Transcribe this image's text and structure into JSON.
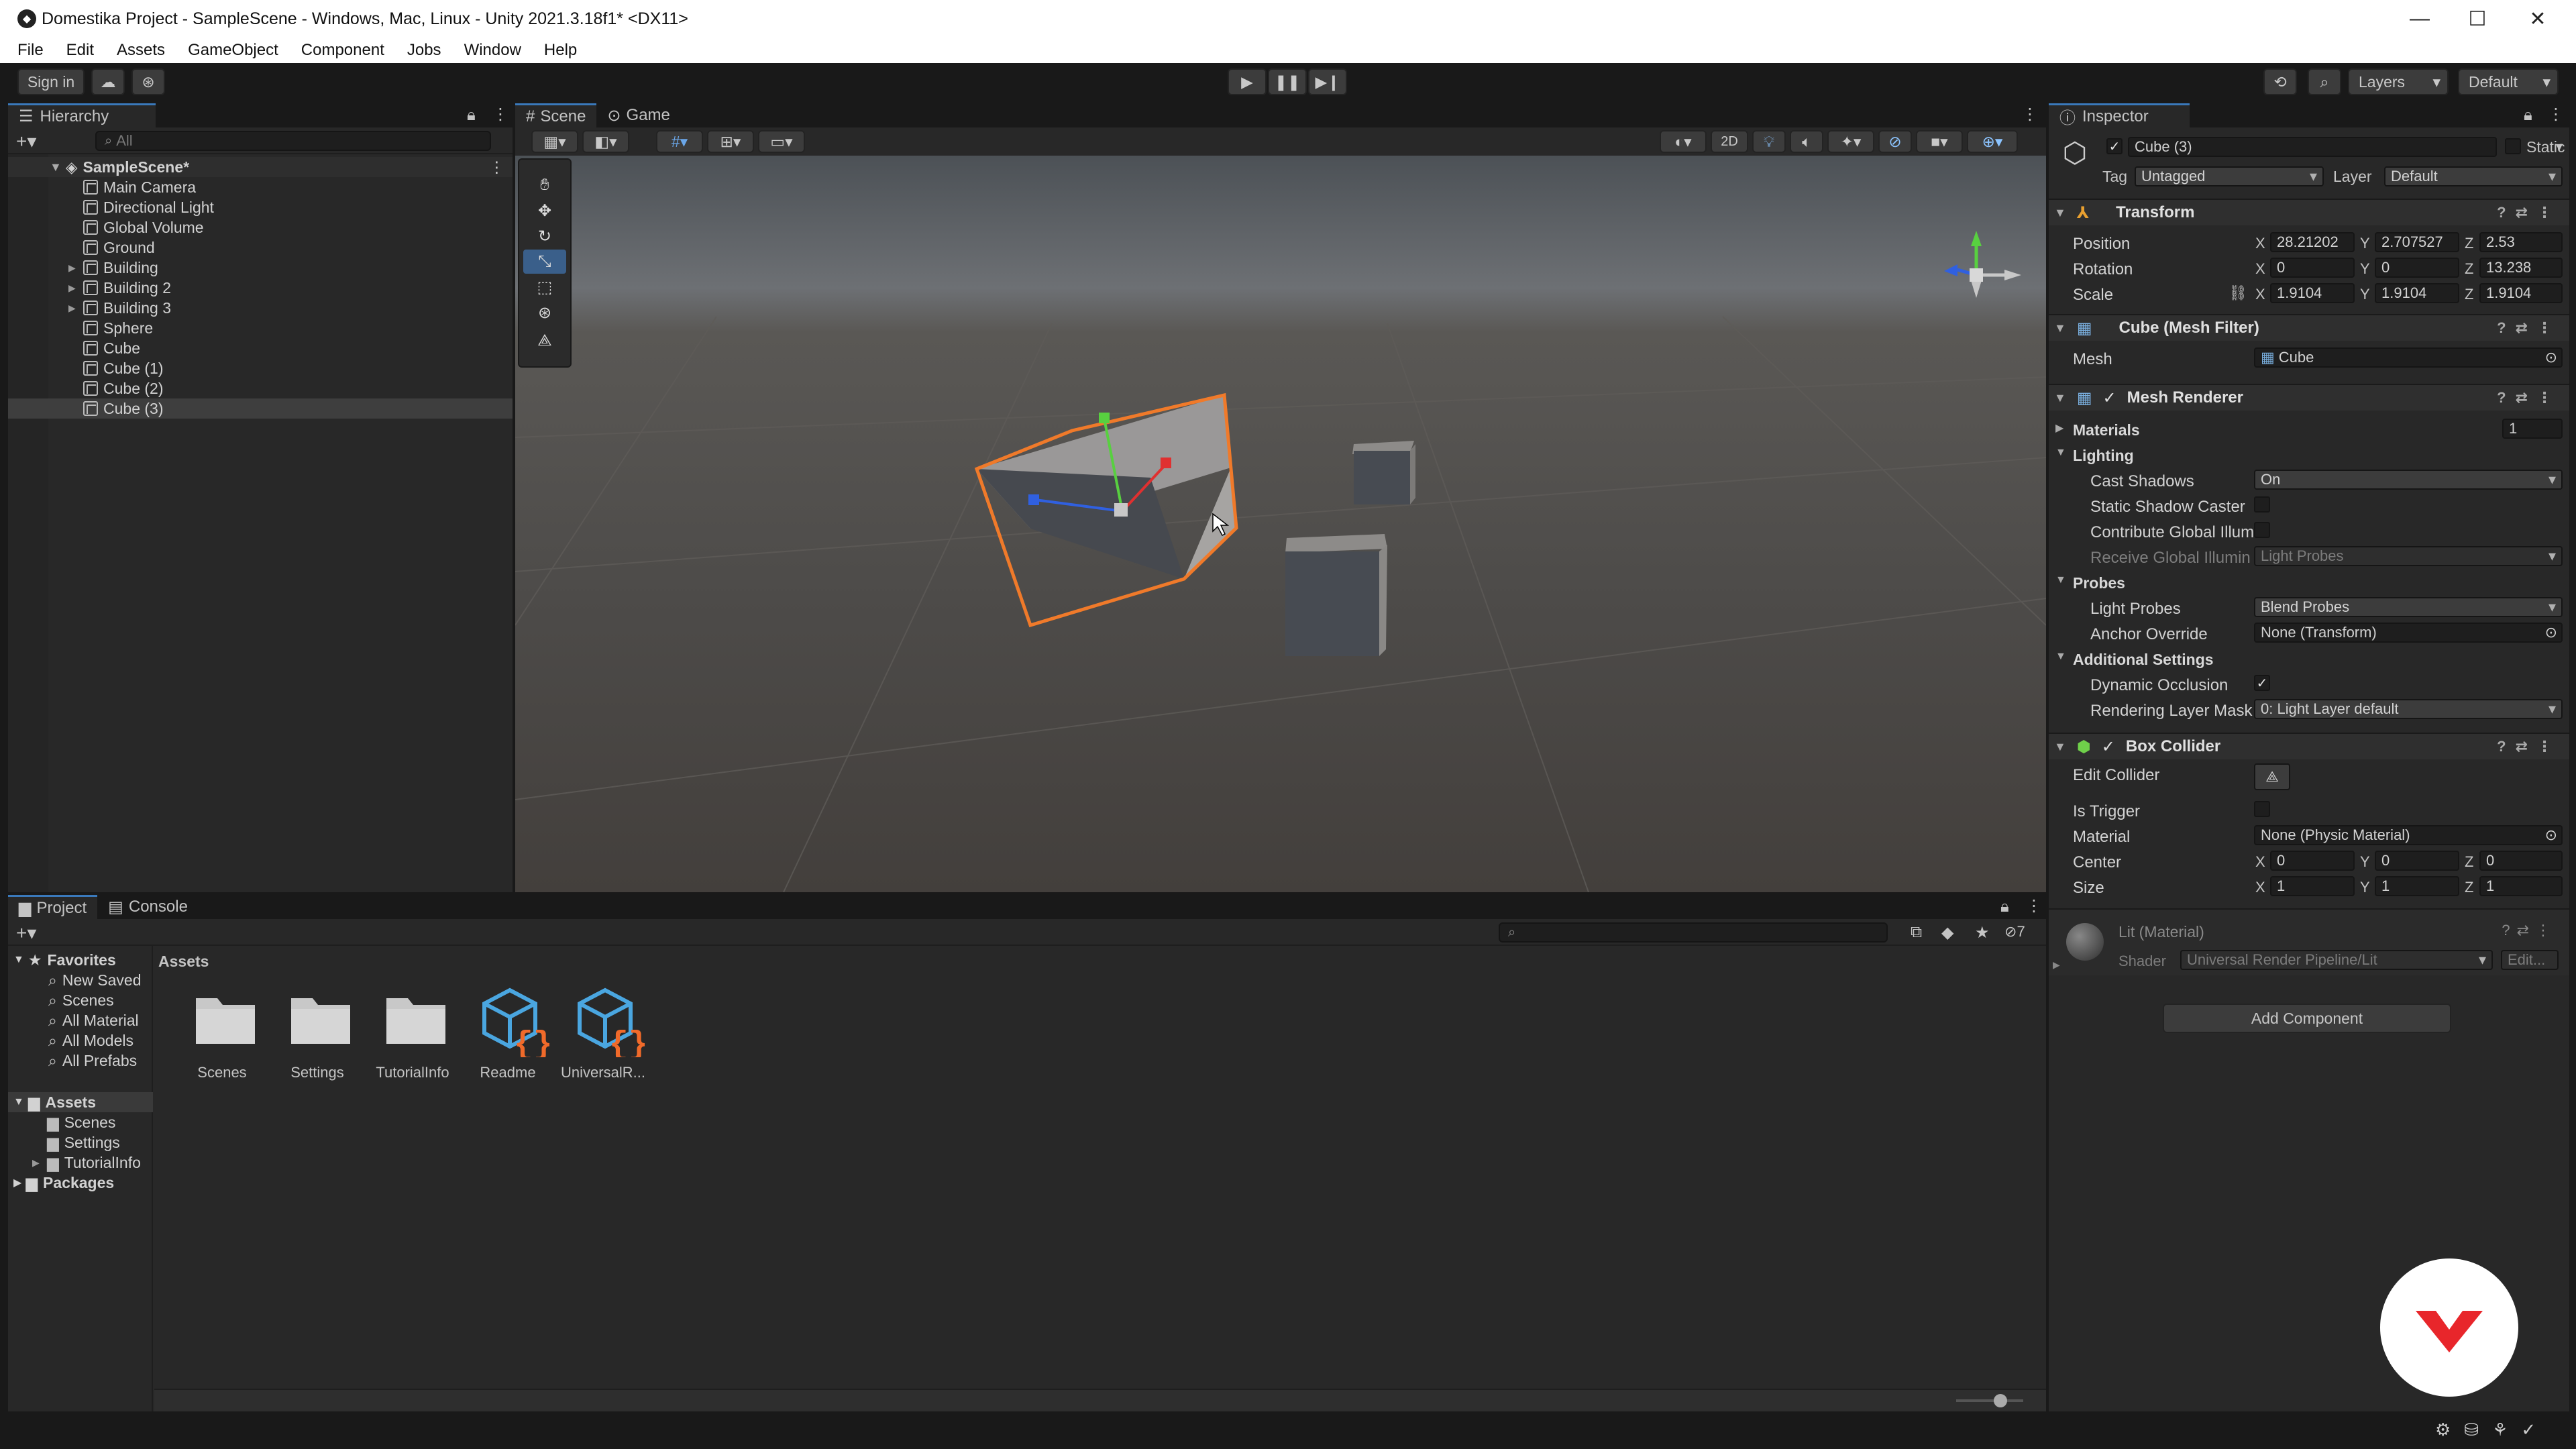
{
  "window": {
    "title": "Domestika Project - SampleScene - Windows, Mac, Linux - Unity 2021.3.18f1* <DX11>"
  },
  "menu": [
    "File",
    "Edit",
    "Assets",
    "GameObject",
    "Component",
    "Jobs",
    "Window",
    "Help"
  ],
  "toolbar": {
    "sign_in": "Sign in",
    "layers": "Layers",
    "layout": "Default"
  },
  "hierarchy": {
    "tab": "Hierarchy",
    "search_placeholder": "All",
    "scene": "SampleScene*",
    "items": [
      {
        "label": "Main Camera",
        "expandable": false
      },
      {
        "label": "Directional Light",
        "expandable": false
      },
      {
        "label": "Global Volume",
        "expandable": false
      },
      {
        "label": "Ground",
        "expandable": false
      },
      {
        "label": "Building",
        "expandable": true
      },
      {
        "label": "Building 2",
        "expandable": true
      },
      {
        "label": "Building 3",
        "expandable": true
      },
      {
        "label": "Sphere",
        "expandable": false
      },
      {
        "label": "Cube",
        "expandable": false
      },
      {
        "label": "Cube (1)",
        "expandable": false
      },
      {
        "label": "Cube (2)",
        "expandable": false
      },
      {
        "label": "Cube (3)",
        "expandable": false,
        "selected": true
      }
    ]
  },
  "scene_view": {
    "tabs": [
      "Scene",
      "Game"
    ],
    "mode_2d": "2D"
  },
  "inspector": {
    "tab": "Inspector",
    "object_name": "Cube (3)",
    "static_label": "Static",
    "tag_label": "Tag",
    "tag_value": "Untagged",
    "layer_label": "Layer",
    "layer_value": "Default",
    "transform": {
      "title": "Transform",
      "position_label": "Position",
      "position": {
        "x": "28.21202",
        "y": "2.707527",
        "z": "2.53"
      },
      "rotation_label": "Rotation",
      "rotation": {
        "x": "0",
        "y": "0",
        "z": "13.238"
      },
      "scale_label": "Scale",
      "scale": {
        "x": "1.9104",
        "y": "1.9104",
        "z": "1.9104"
      }
    },
    "mesh_filter": {
      "title": "Cube (Mesh Filter)",
      "mesh_label": "Mesh",
      "mesh_value": "Cube"
    },
    "mesh_renderer": {
      "title": "Mesh Renderer",
      "materials_label": "Materials",
      "materials_count": "1",
      "lighting_label": "Lighting",
      "cast_shadows_label": "Cast Shadows",
      "cast_shadows_value": "On",
      "static_shadow_label": "Static Shadow Caster",
      "contribute_gi_label": "Contribute Global Illum",
      "receive_gi_label": "Receive Global Illumin",
      "receive_gi_value": "Light Probes",
      "probes_label": "Probes",
      "light_probes_label": "Light Probes",
      "light_probes_value": "Blend Probes",
      "anchor_label": "Anchor Override",
      "anchor_value": "None (Transform)",
      "additional_label": "Additional Settings",
      "dyn_occlusion_label": "Dynamic Occlusion",
      "render_layer_label": "Rendering Layer Mask",
      "render_layer_value": "0: Light Layer default"
    },
    "box_collider": {
      "title": "Box Collider",
      "edit_label": "Edit Collider",
      "trigger_label": "Is Trigger",
      "material_label": "Material",
      "material_value": "None (Physic Material)",
      "center_label": "Center",
      "center": {
        "x": "0",
        "y": "0",
        "z": "0"
      },
      "size_label": "Size",
      "size": {
        "x": "1",
        "y": "1",
        "z": "1"
      }
    },
    "material": {
      "title": "Lit (Material)",
      "shader_label": "Shader",
      "shader_value": "Universal Render Pipeline/Lit",
      "edit": "Edit..."
    },
    "add_component": "Add Component"
  },
  "project": {
    "tabs": [
      "Project",
      "Console"
    ],
    "favorites_label": "Favorites",
    "favorites": [
      "New Saved",
      "Scenes",
      "All Material",
      "All Models",
      "All Prefabs"
    ],
    "assets_label": "Assets",
    "asset_tree": [
      "Scenes",
      "Settings",
      "TutorialInfo"
    ],
    "packages_label": "Packages",
    "breadcrumb": "Assets",
    "hidden_count": "7",
    "grid": [
      {
        "label": "Scenes",
        "type": "folder"
      },
      {
        "label": "Settings",
        "type": "folder"
      },
      {
        "label": "TutorialInfo",
        "type": "folder"
      },
      {
        "label": "Readme",
        "type": "script"
      },
      {
        "label": "UniversalR...",
        "type": "script"
      }
    ]
  },
  "colors": {
    "accent": "#3a79bb",
    "selection_outline": "#f07a2a",
    "brand": "#e8262b"
  }
}
